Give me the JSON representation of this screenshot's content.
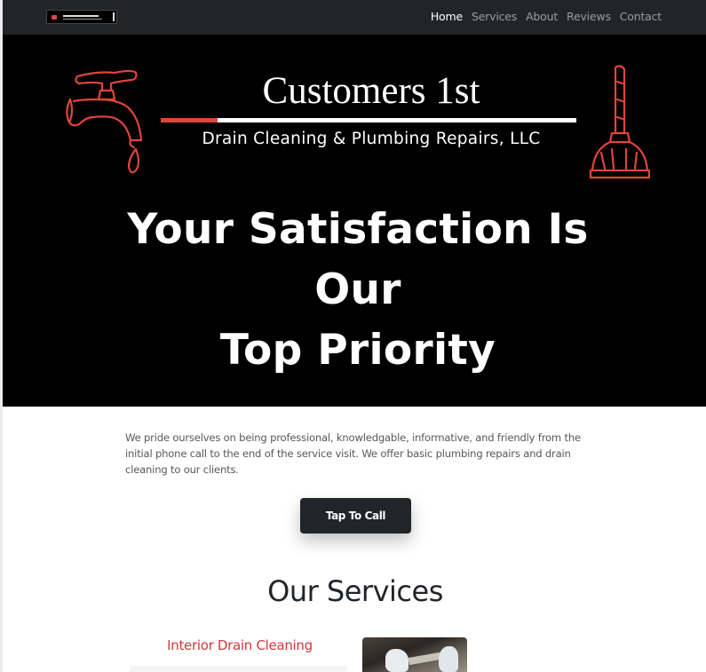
{
  "nav": {
    "logo_icon": "company-logo",
    "links": [
      "Home",
      "Services",
      "About",
      "Reviews",
      "Contact"
    ],
    "active": "Home"
  },
  "hero": {
    "brand_name": "Customers 1st",
    "brand_tagline": "Drain Cleaning & Plumbing Repairs, LLC",
    "headline_lines": [
      "Your Satisfaction Is",
      "Our",
      "Top Priority"
    ],
    "left_icon": "faucet-icon",
    "right_icon": "plunger-icon",
    "accent_color": "#e0443b"
  },
  "intro": {
    "text": "We pride ourselves on being professional, knowledgable, informative, and friendly from the initial phone call to the end of the service visit. We offer basic plumbing repairs and drain cleaning to our clients."
  },
  "cta": {
    "label": "Tap To Call"
  },
  "services": {
    "title": "Our Services",
    "items": [
      {
        "name": "Interior Drain Cleaning",
        "image": "plumber-hands-photo"
      }
    ]
  }
}
